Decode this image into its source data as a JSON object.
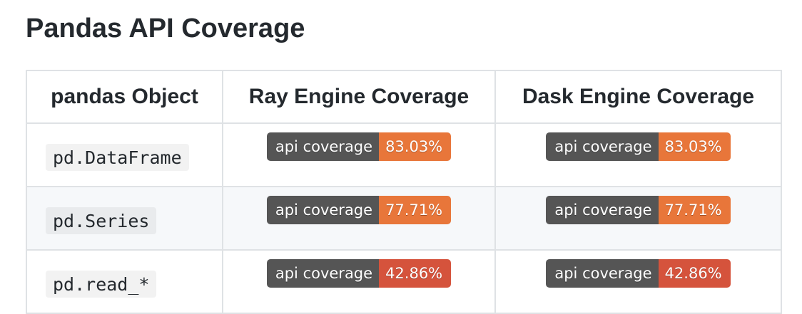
{
  "page": {
    "title": "Pandas API Coverage"
  },
  "table": {
    "headers": [
      "pandas Object",
      "Ray Engine Coverage",
      "Dask Engine Coverage"
    ],
    "rows": [
      {
        "object": "pd.DataFrame",
        "ray": {
          "label": "api coverage",
          "value": "83.03%",
          "color": "#e8763a"
        },
        "dask": {
          "label": "api coverage",
          "value": "83.03%",
          "color": "#e8763a"
        }
      },
      {
        "object": "pd.Series",
        "ray": {
          "label": "api coverage",
          "value": "77.71%",
          "color": "#e8763a"
        },
        "dask": {
          "label": "api coverage",
          "value": "77.71%",
          "color": "#e8763a"
        }
      },
      {
        "object": "pd.read_*",
        "ray": {
          "label": "api coverage",
          "value": "42.86%",
          "color": "#d5533c"
        },
        "dask": {
          "label": "api coverage",
          "value": "42.86%",
          "color": "#d5533c"
        }
      }
    ]
  },
  "colors": {
    "badge_label_bg": "#555555",
    "alt_row_bg": "#f6f8fa",
    "border": "#dfe2e5"
  }
}
